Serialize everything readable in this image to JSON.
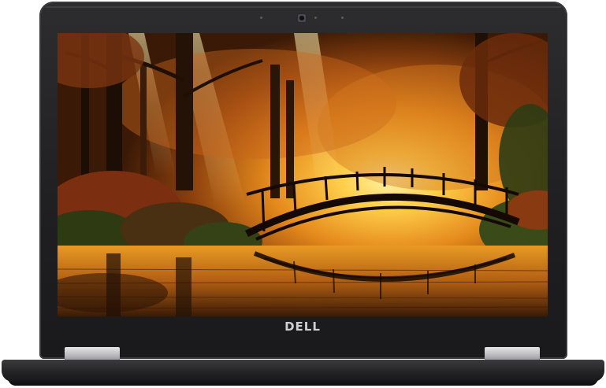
{
  "device": {
    "brand_logo": "DELL",
    "frame_color": "#262628",
    "hinge_color": "#c4c4c8"
  },
  "screen": {
    "wallpaper": "autumn-forest-arched-bridge-over-pond",
    "dominant_colors": [
      "#f2a22a",
      "#8a3b0c",
      "#2a1808",
      "#3d5a20"
    ]
  }
}
